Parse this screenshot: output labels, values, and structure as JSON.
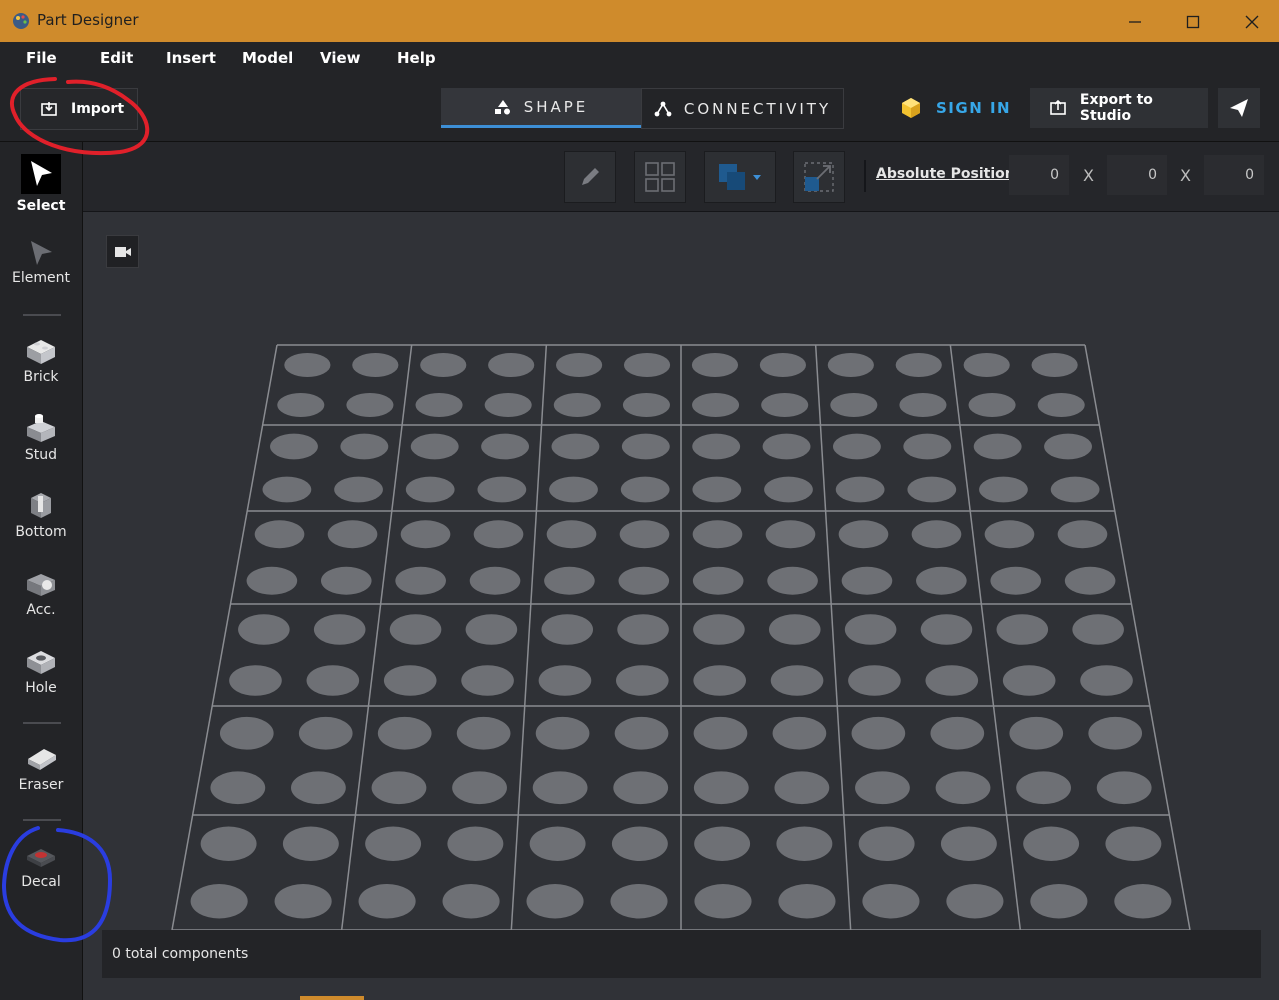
{
  "window": {
    "title": "Part Designer",
    "accent": "#cf8b2c"
  },
  "menu": [
    "File",
    "Edit",
    "Insert",
    "Model",
    "View",
    "Help"
  ],
  "toolbar": {
    "import_label": "Import",
    "tabs": [
      {
        "label": "SHAPE",
        "active": true
      },
      {
        "label": "CONNECTIVITY",
        "active": false
      }
    ],
    "signin_label": "SIGN IN",
    "export_label": "Export to Studio"
  },
  "tools": [
    {
      "label": "Select",
      "icon": "cursor-icon",
      "selected": true
    },
    {
      "label": "Element",
      "icon": "element-cursor-icon"
    },
    {
      "label": "Brick",
      "icon": "brick-icon"
    },
    {
      "label": "Stud",
      "icon": "stud-icon"
    },
    {
      "label": "Bottom",
      "icon": "bottom-icon"
    },
    {
      "label": "Acc.",
      "icon": "accessory-icon"
    },
    {
      "label": "Hole",
      "icon": "hole-icon"
    },
    {
      "label": "Eraser",
      "icon": "eraser-icon"
    },
    {
      "label": "Decal",
      "icon": "decal-icon"
    }
  ],
  "position": {
    "label": "Absolute Position",
    "x": "0",
    "y": "0",
    "z": "0",
    "separator": "X"
  },
  "grid": {
    "rows": 6,
    "cols": 6,
    "studs_per_cell": 4
  },
  "status": "0 total components",
  "colors": {
    "highlight_blue": "#3d8fd6",
    "signin_blue": "#37a7e8",
    "annotation_red": "#e0202a",
    "annotation_blue": "#2a3de0"
  }
}
